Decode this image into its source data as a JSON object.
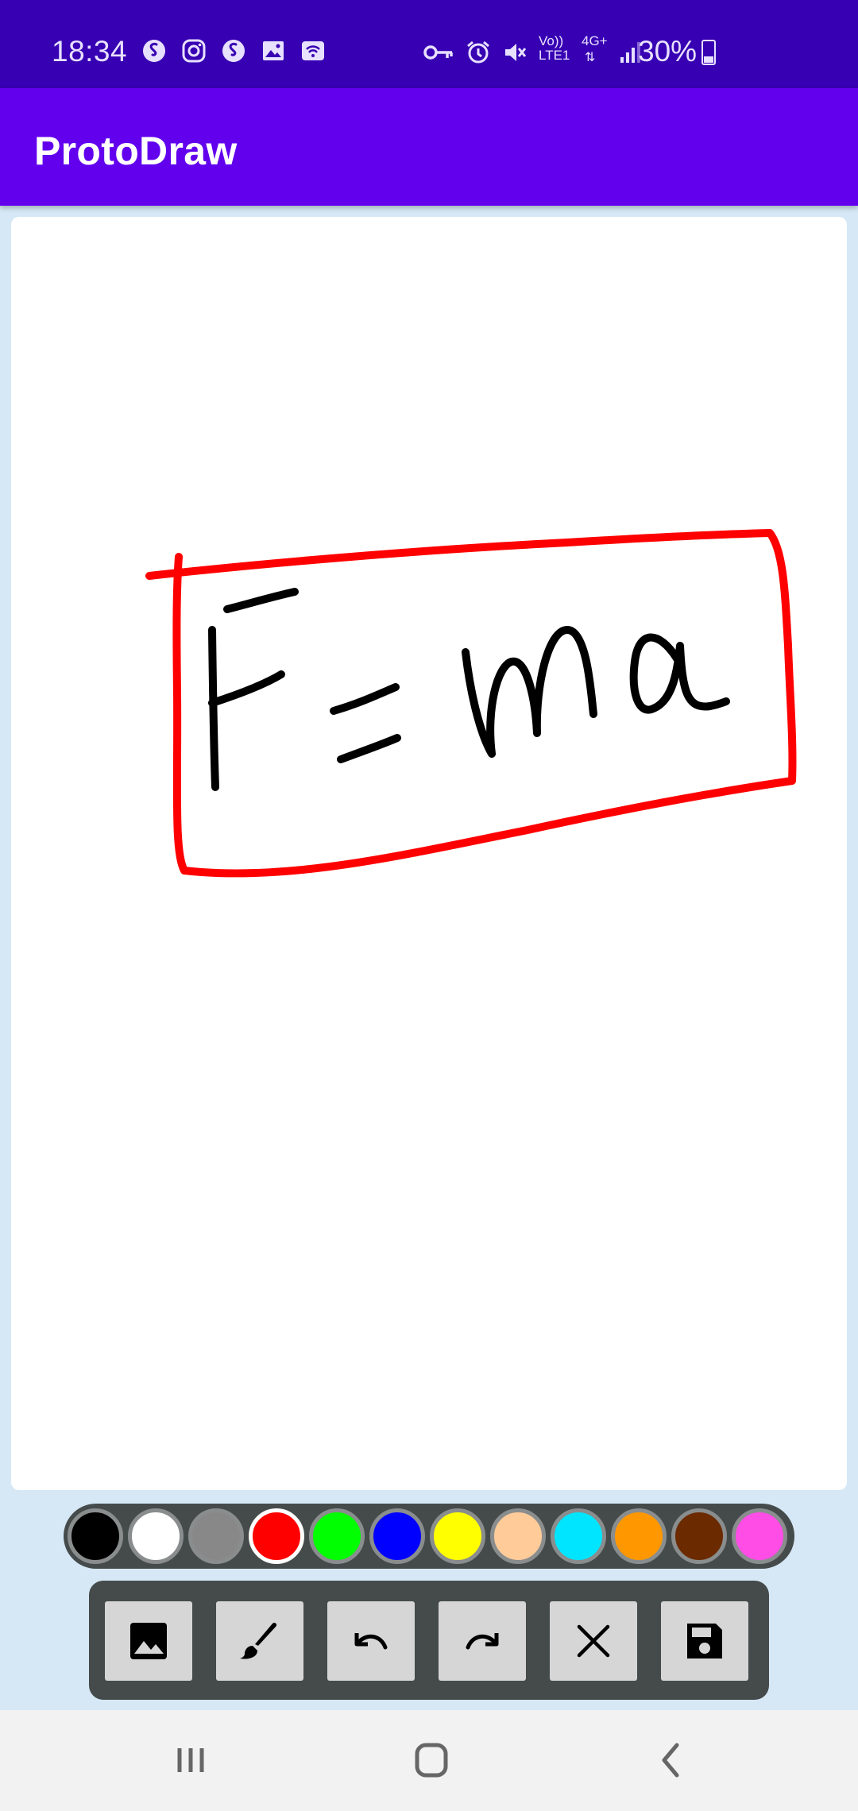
{
  "status_bar": {
    "time": "18:34",
    "battery_percent": "30%",
    "battery_level": 0.3,
    "network": "4G+",
    "lte_label": "LTE1",
    "volte_label": "Vo))",
    "left_icons": [
      "shazam-icon",
      "instagram-icon",
      "shazam-icon",
      "gallery-icon",
      "wifi-hotspot-icon"
    ],
    "right_icons": [
      "vpn-key-icon",
      "alarm-icon",
      "mute-icon",
      "volte-icon",
      "signal-icon"
    ]
  },
  "app_bar": {
    "title": "ProtoDraw"
  },
  "canvas": {
    "background": "#ffffff",
    "drawing_text": "F = ma",
    "stroke_colors": {
      "box": "#ff0000",
      "text": "#000000"
    }
  },
  "palette": {
    "colors": [
      "#000000",
      "#ffffff",
      "#888888",
      "#ff0000",
      "#00ff00",
      "#0000ff",
      "#ffff00",
      "#ffcc99",
      "#00e5ff",
      "#ff9800",
      "#6b2a00",
      "#ff4de6"
    ],
    "selected_index": 3
  },
  "toolbar": {
    "buttons": [
      "image-icon",
      "brush-icon",
      "undo-icon",
      "redo-icon",
      "clear-icon",
      "save-icon"
    ]
  },
  "nav_bar": {
    "buttons": [
      "recent-apps-icon",
      "home-icon",
      "back-icon"
    ]
  },
  "theme": {
    "status_bar": "#3700b3",
    "app_bar": "#6200ee",
    "background": "#d6e8f6",
    "panel": "#454b4b",
    "button": "#d6d6d6"
  }
}
